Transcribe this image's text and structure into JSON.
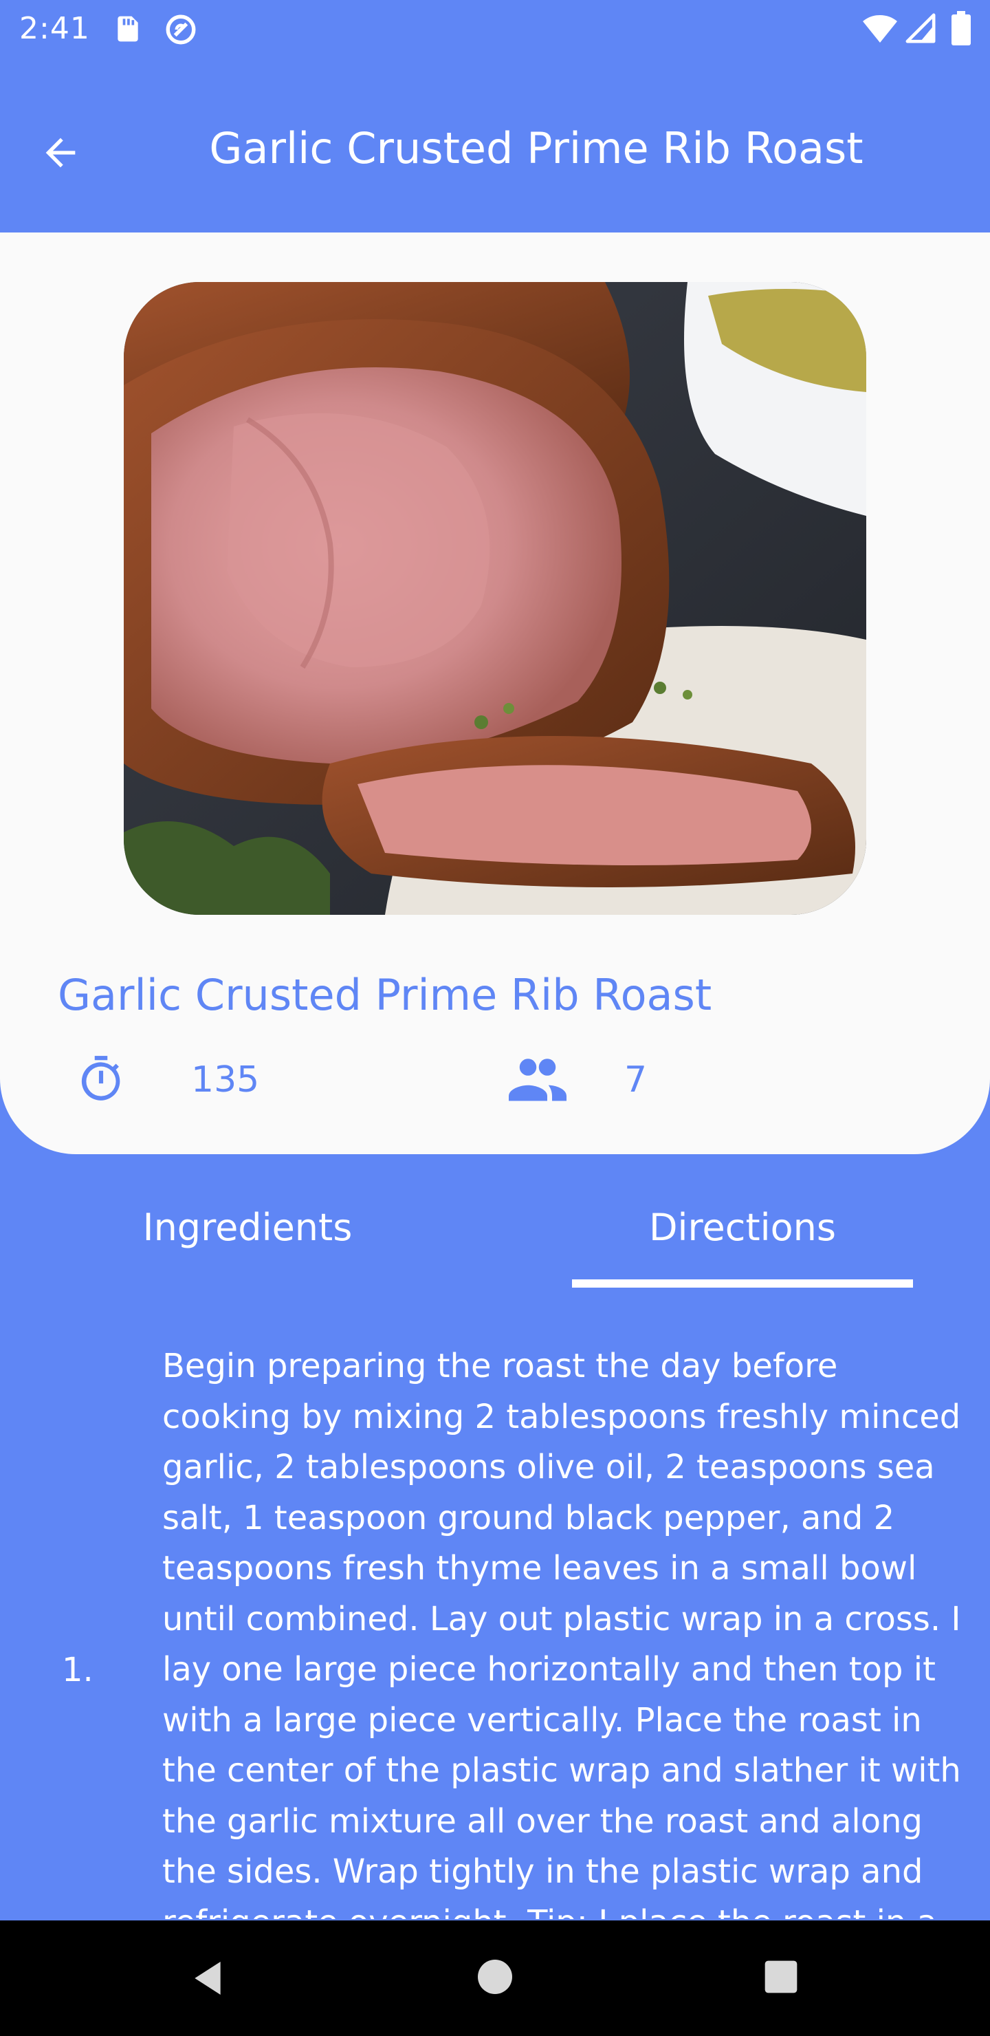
{
  "status_bar": {
    "time": "2:41",
    "icons": [
      "sd-card-icon",
      "sync-icon",
      "wifi-icon",
      "signal-icon",
      "battery-icon"
    ]
  },
  "app_bar": {
    "back_icon": "arrow-left-icon",
    "title": "Garlic Crusted Prime Rib Roast"
  },
  "recipe": {
    "image_description": "sliced prime rib roast",
    "name": "Garlic Crusted Prime Rib Roast",
    "time_icon": "timer-icon",
    "time": "135",
    "servings_icon": "people-icon",
    "servings": "7"
  },
  "tabs": {
    "items": [
      {
        "label": "Ingredients",
        "selected": false
      },
      {
        "label": "Directions",
        "selected": true
      }
    ]
  },
  "directions": {
    "steps": [
      {
        "number": "1.",
        "text": "Begin preparing the roast the day before cooking by mixing 2 tablespoons freshly minced garlic, 2 tablespoons olive oil, 2 teaspoons sea salt, 1 teaspoon ground black pepper, and 2 teaspoons fresh thyme leaves in a small bowl until combined. Lay out plastic wrap in a cross. I lay one large piece horizontally and then top it with a large piece vertically. Place the roast in the center of the plastic wrap and slather it with the garlic mixture all over the roast and along the sides. Wrap tightly in the plastic wrap and refrigerate overnight. Tip: I place the roast in a container to catch any leaks just in case."
      }
    ]
  },
  "colors": {
    "primary": "#5f86f5",
    "card": "#fafafa",
    "text_on_primary": "#ffffff",
    "nav_bar": "#000000"
  },
  "nav_bar": {
    "icons": [
      "nav-back-icon",
      "nav-home-icon",
      "nav-recents-icon"
    ]
  }
}
